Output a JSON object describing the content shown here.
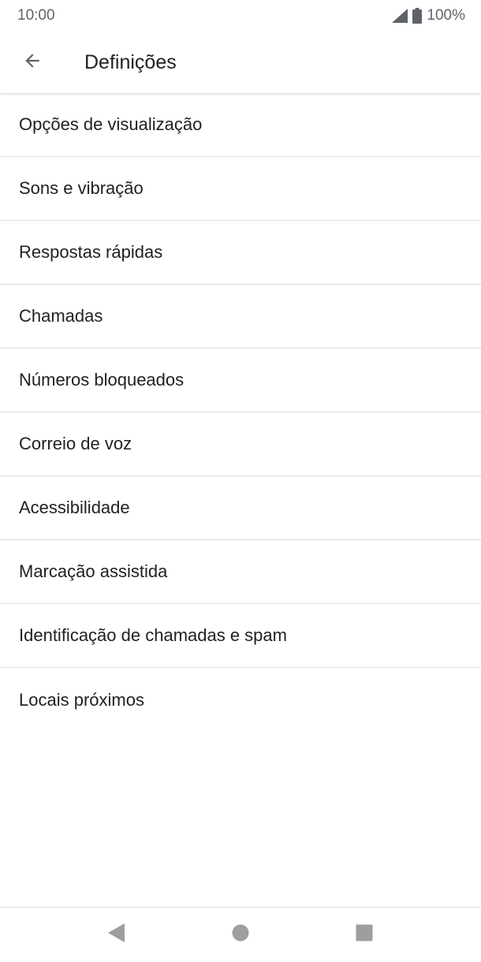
{
  "status_bar": {
    "time": "10:00",
    "battery_text": "100%",
    "icons": [
      "signal-icon",
      "battery-icon"
    ]
  },
  "app_bar": {
    "title": "Definições",
    "back_icon": "arrow-back-icon"
  },
  "settings": {
    "items": [
      {
        "label": "Opções de visualização"
      },
      {
        "label": "Sons e vibração"
      },
      {
        "label": "Respostas rápidas"
      },
      {
        "label": "Chamadas"
      },
      {
        "label": "Números bloqueados"
      },
      {
        "label": "Correio de voz"
      },
      {
        "label": "Acessibilidade"
      },
      {
        "label": "Marcação assistida"
      },
      {
        "label": "Identificação de chamadas e spam"
      },
      {
        "label": "Locais próximos"
      }
    ]
  },
  "nav_bar": {
    "icons": [
      "nav-back-icon",
      "nav-home-icon",
      "nav-recents-icon"
    ]
  },
  "colors": {
    "text_primary": "#202124",
    "text_secondary": "#5f6368",
    "divider": "#dadce0",
    "nav_icon": "#9e9e9e"
  }
}
